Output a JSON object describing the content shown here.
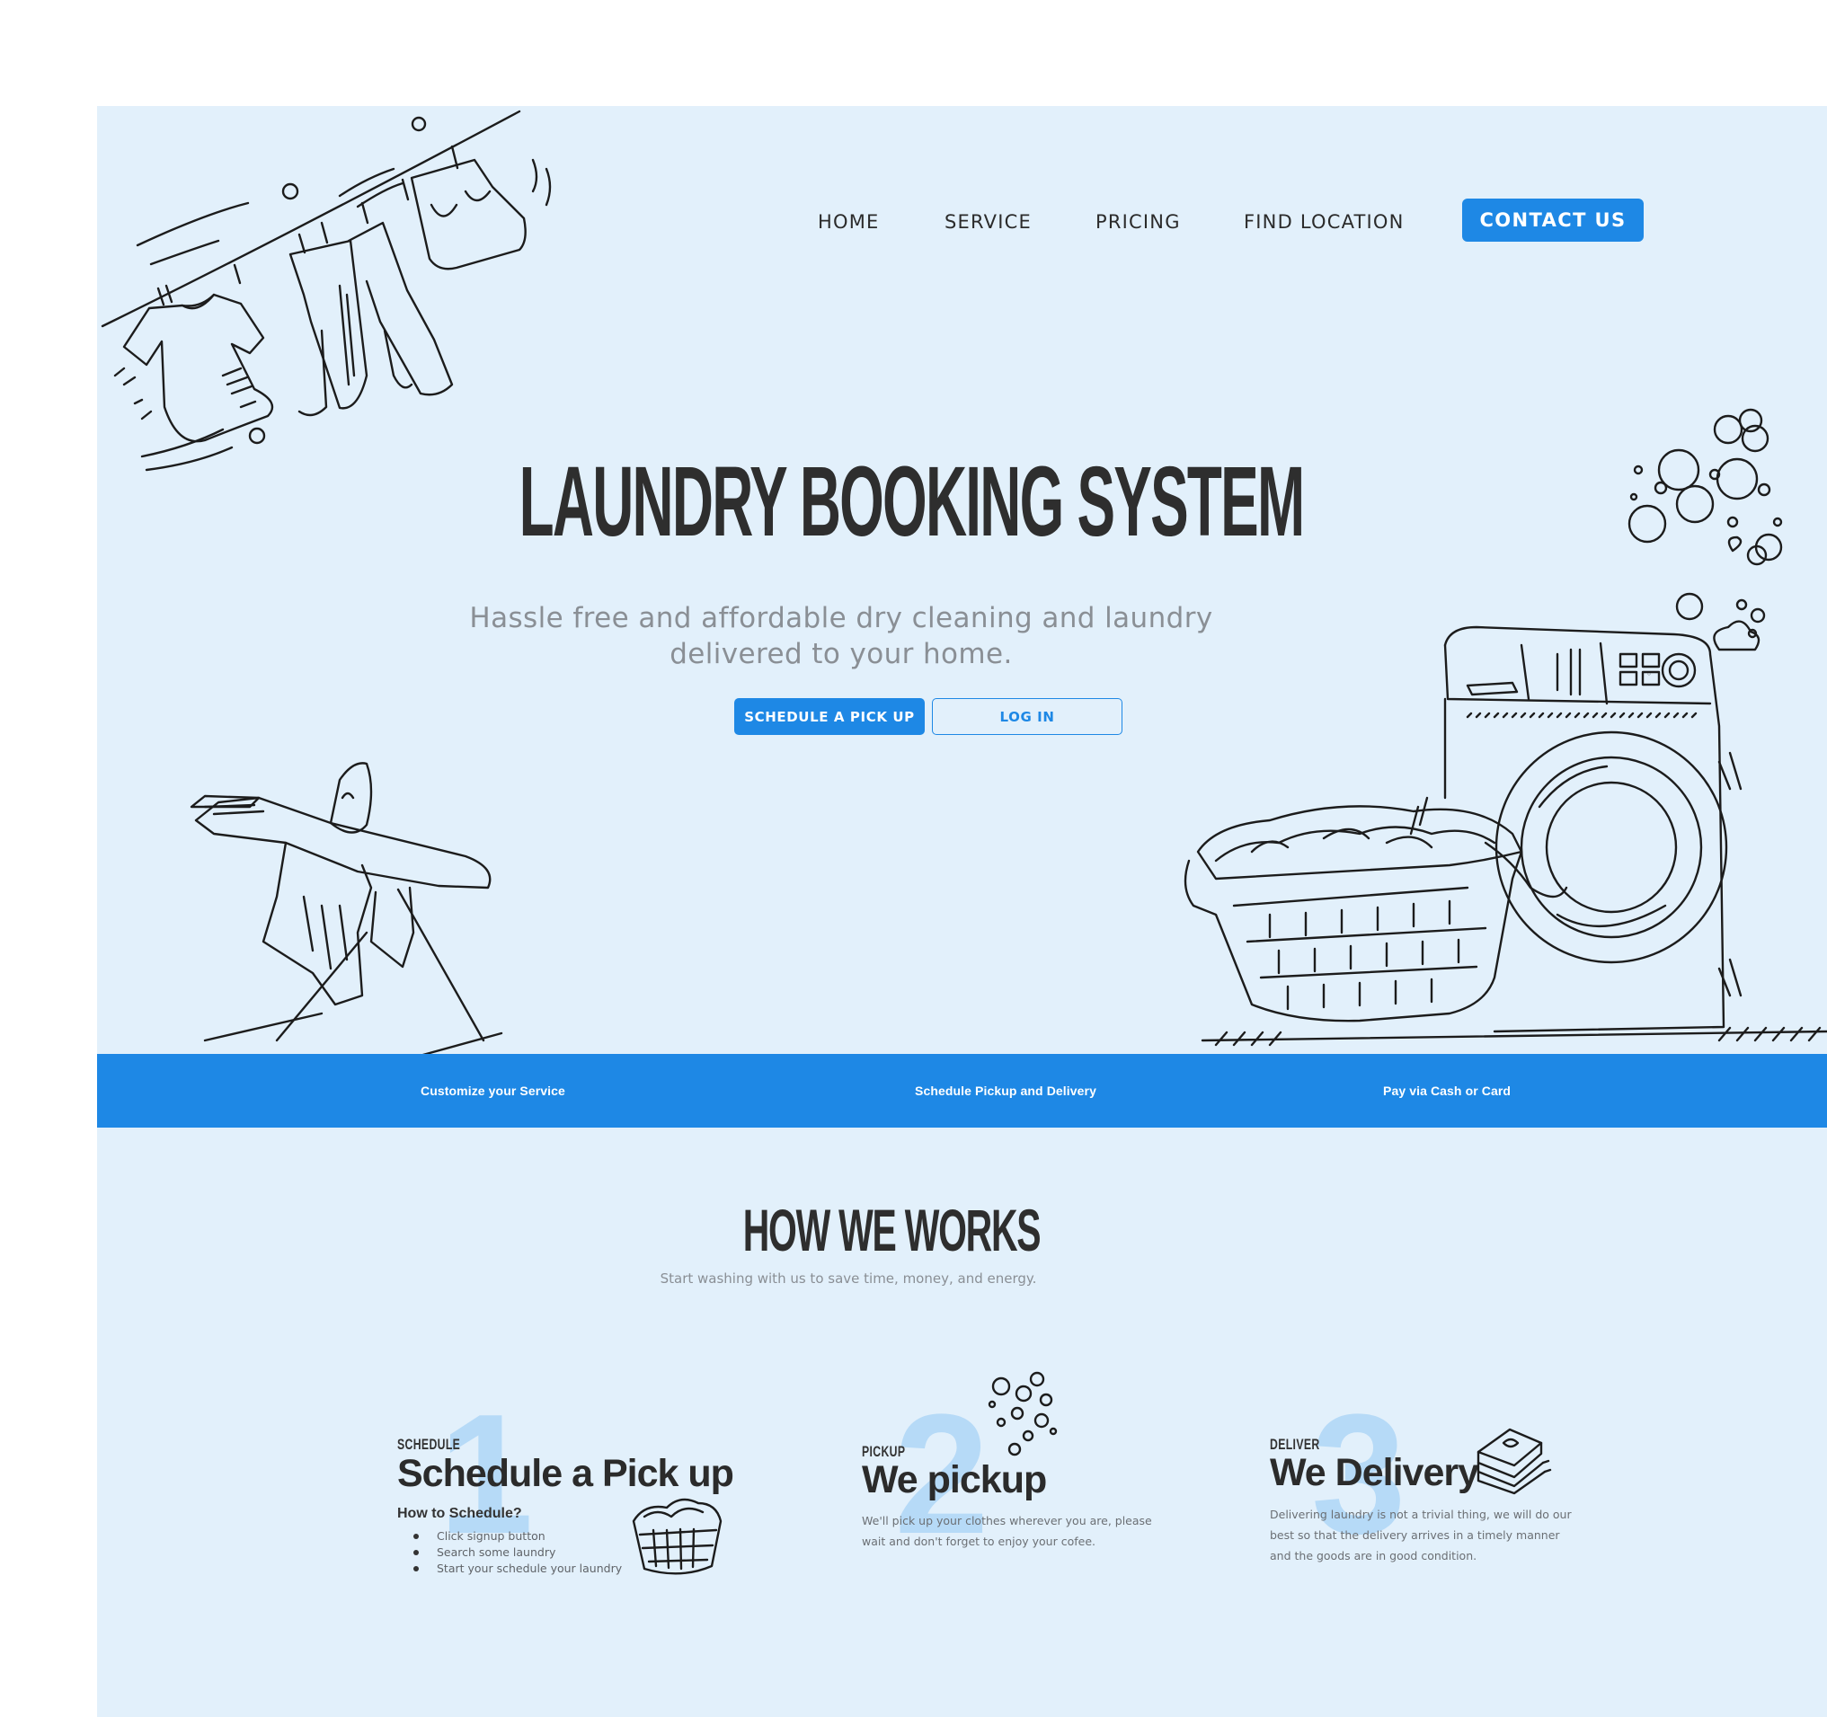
{
  "nav": {
    "items": [
      "HOME",
      "SERVICE",
      "PRICING",
      "FIND LOCATION"
    ],
    "contact_label": "CONTACT  US"
  },
  "hero": {
    "title": "LAUNDRY BOOKING SYSTEM",
    "subtitle_line1": "Hassle free and affordable dry cleaning and laundry",
    "subtitle_line2": "delivered to your home.",
    "primary_cta": "SCHEDULE A PICK UP",
    "secondary_cta": "LOG IN"
  },
  "band": {
    "items": [
      "Customize your Service",
      "Schedule Pickup and Delivery",
      "Pay via Cash or Card"
    ]
  },
  "how": {
    "title": "HOW WE WORKS",
    "subtitle": "Start  washing with us to save time, money, and energy.",
    "steps": [
      {
        "number": "1",
        "kicker": "SCHEDULE",
        "heading": "Schedule a Pick up",
        "how_to": "How to Schedule?",
        "bullets": [
          "Click signup button",
          "Search some laundry",
          "Start your schedule your laundry"
        ]
      },
      {
        "number": "2",
        "kicker": "PICKUP",
        "heading": "We pickup",
        "desc_line1": "We'll pick up your clothes wherever you are, please",
        "desc_line2": "wait and don't forget to enjoy your cofee."
      },
      {
        "number": "3",
        "kicker": "DELIVER",
        "heading": "We Delivery",
        "desc_line1": "Delivering laundry is not a trivial thing, we will do our",
        "desc_line2": "best so that the delivery arrives in a timely manner",
        "desc_line3": "and the goods are in good condition."
      }
    ]
  },
  "colors": {
    "page_bg": "#e2f0fb",
    "accent": "#1e88e5",
    "number_tint": "#b6daf7",
    "text_dark": "#2b2b2b",
    "text_muted": "#8a8f95"
  },
  "icons": [
    "clothesline-illustration",
    "ironing-board-illustration",
    "washing-machine-illustration",
    "bubbles-illustration",
    "laundry-basket-icon",
    "folded-clothes-icon"
  ]
}
